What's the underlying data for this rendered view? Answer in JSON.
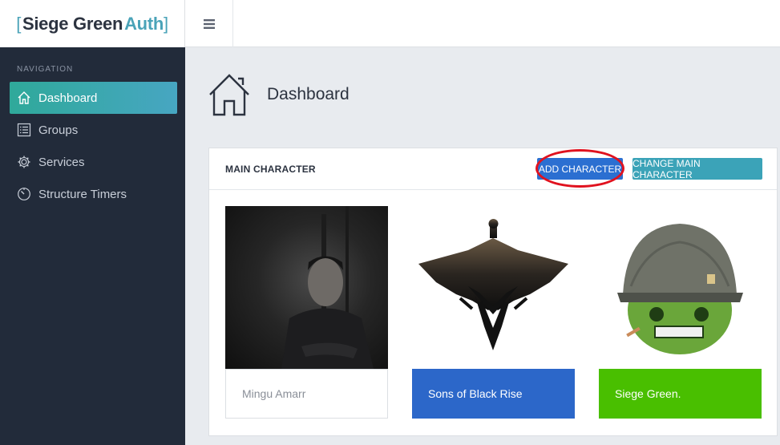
{
  "brand": {
    "open": "[",
    "name": "Siege Green",
    "accent": "Auth",
    "close": "]"
  },
  "sidebar": {
    "heading": "NAVIGATION",
    "items": [
      {
        "label": "Dashboard",
        "icon": "home-icon",
        "active": true
      },
      {
        "label": "Groups",
        "icon": "list-icon",
        "active": false
      },
      {
        "label": "Services",
        "icon": "gear-icon",
        "active": false
      },
      {
        "label": "Structure Timers",
        "icon": "timer-icon",
        "active": false
      }
    ]
  },
  "topbar": {
    "menu_icon": "hamburger-icon"
  },
  "page": {
    "title": "Dashboard",
    "icon": "home-outline-icon"
  },
  "card": {
    "title": "MAIN CHARACTER",
    "add_button": "ADD CHARACTER",
    "change_button": "CHANGE MAIN CHARACTER",
    "tiles": [
      {
        "label": "Mingu Amarr",
        "kind": "character-portrait"
      },
      {
        "label": "Sons of Black Rise",
        "kind": "corporation-logo"
      },
      {
        "label": "Siege Green.",
        "kind": "alliance-logo"
      }
    ]
  },
  "colors": {
    "sidebar_bg": "#222b3a",
    "active_nav": "#3aa7ad",
    "add_button": "#2b6fd1",
    "change_button": "#3ba3b8",
    "corp_tile": "#2c67c9",
    "alliance_tile": "#49bf00",
    "highlight_ring": "#e0121f"
  }
}
